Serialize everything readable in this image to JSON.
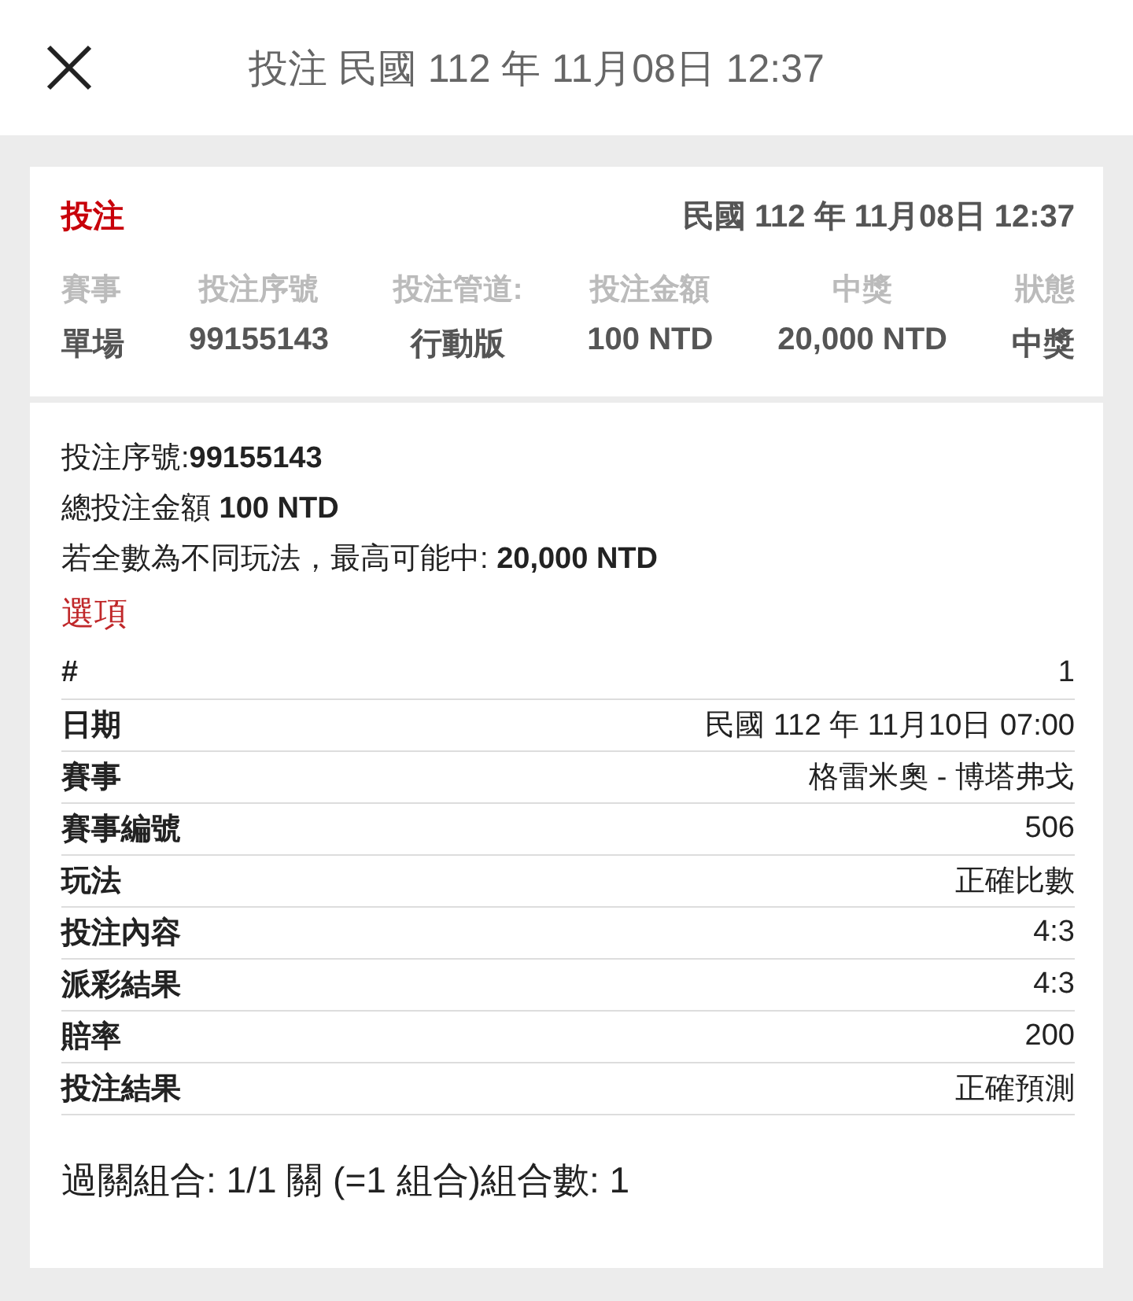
{
  "header": {
    "title": "投注 民國 112 年 11月08日 12:37"
  },
  "summary": {
    "label": "投注",
    "date": "民國 112 年 11月08日 12:37",
    "columns": [
      {
        "heading": "賽事",
        "value": "單場"
      },
      {
        "heading": "投注序號",
        "value": "99155143"
      },
      {
        "heading": "投注管道:",
        "value": "行動版"
      },
      {
        "heading": "投注金額",
        "value": "100 NTD"
      },
      {
        "heading": "中獎",
        "value": "20,000 NTD"
      },
      {
        "heading": "狀態",
        "value": "中獎"
      }
    ]
  },
  "details": {
    "lines": [
      "投注序號:**99155143**",
      "總投注金額 **100 NTD**",
      "若全數為不同玩法，最高可能中: **20,000 NTD**"
    ],
    "options_heading": "選項",
    "rows": [
      {
        "label": "#",
        "value": "1"
      },
      {
        "label": "日期",
        "value": "民國 112 年 11月10日 07:00"
      },
      {
        "label": "賽事",
        "value": "格雷米奧 - 博塔弗戈"
      },
      {
        "label": "賽事編號",
        "value": "506"
      },
      {
        "label": "玩法",
        "value": "正確比數"
      },
      {
        "label": "投注內容",
        "value": "4:3"
      },
      {
        "label": "派彩結果",
        "value": "4:3"
      },
      {
        "label": "賠率",
        "value": "200"
      },
      {
        "label": "投注結果",
        "value": "正確預測"
      }
    ],
    "combination": "過關組合: 1/1 關 (=1 組合)組合數: 1"
  }
}
